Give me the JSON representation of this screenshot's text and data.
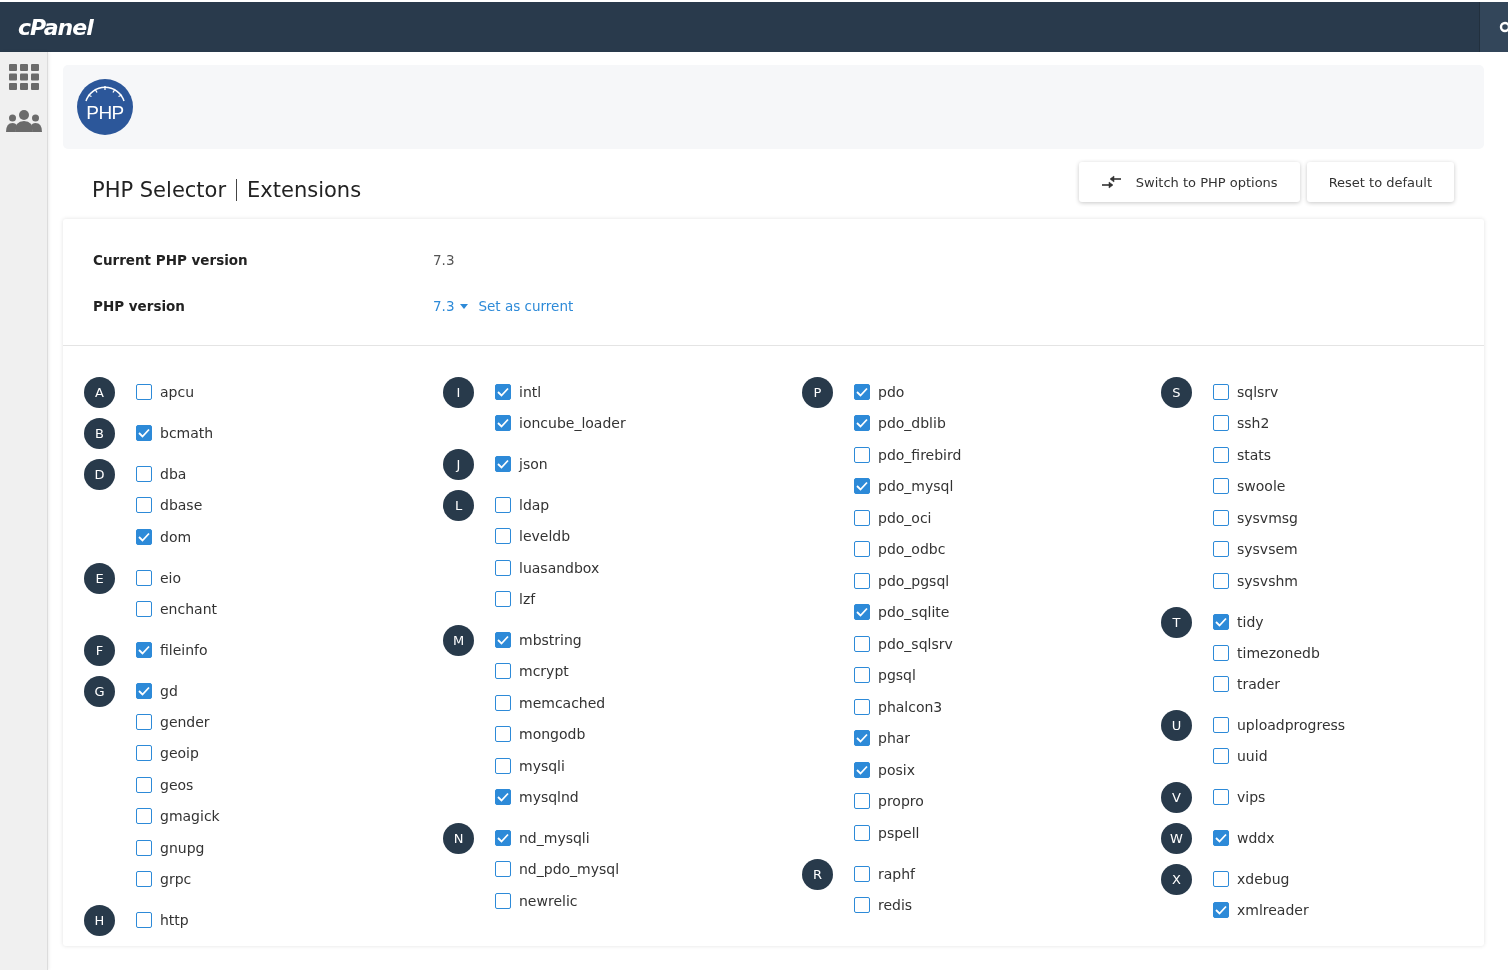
{
  "header": {
    "logo": "cPanel"
  },
  "banner": {
    "logo_text": "PHP"
  },
  "title": {
    "app": "PHP Selector",
    "section": "Extensions"
  },
  "buttons": [
    {
      "kind": "switch",
      "label": "Switch to PHP options"
    },
    {
      "kind": "plain",
      "label": "Reset to default"
    }
  ],
  "info": {
    "current_label": "Current PHP version",
    "current_value": "7.3",
    "version_label": "PHP version",
    "version_value": "7.3",
    "set_current": "Set as current"
  },
  "columns": [
    {
      "groups": [
        {
          "letter": "A",
          "extensions": [
            {
              "name": "apcu",
              "checked": false
            }
          ]
        },
        {
          "letter": "B",
          "extensions": [
            {
              "name": "bcmath",
              "checked": true
            }
          ]
        },
        {
          "letter": "D",
          "extensions": [
            {
              "name": "dba",
              "checked": false
            },
            {
              "name": "dbase",
              "checked": false
            },
            {
              "name": "dom",
              "checked": true
            }
          ]
        },
        {
          "letter": "E",
          "extensions": [
            {
              "name": "eio",
              "checked": false
            },
            {
              "name": "enchant",
              "checked": false
            }
          ]
        },
        {
          "letter": "F",
          "extensions": [
            {
              "name": "fileinfo",
              "checked": true
            }
          ]
        },
        {
          "letter": "G",
          "extensions": [
            {
              "name": "gd",
              "checked": true
            },
            {
              "name": "gender",
              "checked": false
            },
            {
              "name": "geoip",
              "checked": false
            },
            {
              "name": "geos",
              "checked": false
            },
            {
              "name": "gmagick",
              "checked": false
            },
            {
              "name": "gnupg",
              "checked": false
            },
            {
              "name": "grpc",
              "checked": false
            }
          ]
        },
        {
          "letter": "H",
          "extensions": [
            {
              "name": "http",
              "checked": false
            }
          ]
        }
      ]
    },
    {
      "groups": [
        {
          "letter": "I",
          "extensions": [
            {
              "name": "intl",
              "checked": true
            },
            {
              "name": "ioncube_loader",
              "checked": true
            }
          ]
        },
        {
          "letter": "J",
          "extensions": [
            {
              "name": "json",
              "checked": true
            }
          ]
        },
        {
          "letter": "L",
          "extensions": [
            {
              "name": "ldap",
              "checked": false
            },
            {
              "name": "leveldb",
              "checked": false
            },
            {
              "name": "luasandbox",
              "checked": false
            },
            {
              "name": "lzf",
              "checked": false
            }
          ]
        },
        {
          "letter": "M",
          "extensions": [
            {
              "name": "mbstring",
              "checked": true
            },
            {
              "name": "mcrypt",
              "checked": false
            },
            {
              "name": "memcached",
              "checked": false
            },
            {
              "name": "mongodb",
              "checked": false
            },
            {
              "name": "mysqli",
              "checked": false
            },
            {
              "name": "mysqlnd",
              "checked": true
            }
          ]
        },
        {
          "letter": "N",
          "extensions": [
            {
              "name": "nd_mysqli",
              "checked": true
            },
            {
              "name": "nd_pdo_mysql",
              "checked": false
            },
            {
              "name": "newrelic",
              "checked": false
            }
          ]
        }
      ]
    },
    {
      "groups": [
        {
          "letter": "P",
          "extensions": [
            {
              "name": "pdo",
              "checked": true
            },
            {
              "name": "pdo_dblib",
              "checked": true
            },
            {
              "name": "pdo_firebird",
              "checked": false
            },
            {
              "name": "pdo_mysql",
              "checked": true
            },
            {
              "name": "pdo_oci",
              "checked": false
            },
            {
              "name": "pdo_odbc",
              "checked": false
            },
            {
              "name": "pdo_pgsql",
              "checked": false
            },
            {
              "name": "pdo_sqlite",
              "checked": true
            },
            {
              "name": "pdo_sqlsrv",
              "checked": false
            },
            {
              "name": "pgsql",
              "checked": false
            },
            {
              "name": "phalcon3",
              "checked": false
            },
            {
              "name": "phar",
              "checked": true
            },
            {
              "name": "posix",
              "checked": true
            },
            {
              "name": "propro",
              "checked": false
            },
            {
              "name": "pspell",
              "checked": false
            }
          ]
        },
        {
          "letter": "R",
          "extensions": [
            {
              "name": "raphf",
              "checked": false
            },
            {
              "name": "redis",
              "checked": false
            }
          ]
        }
      ]
    },
    {
      "groups": [
        {
          "letter": "S",
          "extensions": [
            {
              "name": "sqlsrv",
              "checked": false
            },
            {
              "name": "ssh2",
              "checked": false
            },
            {
              "name": "stats",
              "checked": false
            },
            {
              "name": "swoole",
              "checked": false
            },
            {
              "name": "sysvmsg",
              "checked": false
            },
            {
              "name": "sysvsem",
              "checked": false
            },
            {
              "name": "sysvshm",
              "checked": false
            }
          ]
        },
        {
          "letter": "T",
          "extensions": [
            {
              "name": "tidy",
              "checked": true
            },
            {
              "name": "timezonedb",
              "checked": false
            },
            {
              "name": "trader",
              "checked": false
            }
          ]
        },
        {
          "letter": "U",
          "extensions": [
            {
              "name": "uploadprogress",
              "checked": false
            },
            {
              "name": "uuid",
              "checked": false
            }
          ]
        },
        {
          "letter": "V",
          "extensions": [
            {
              "name": "vips",
              "checked": false
            }
          ]
        },
        {
          "letter": "W",
          "extensions": [
            {
              "name": "wddx",
              "checked": true
            }
          ]
        },
        {
          "letter": "X",
          "extensions": [
            {
              "name": "xdebug",
              "checked": false
            },
            {
              "name": "xmlreader",
              "checked": true
            }
          ]
        }
      ]
    }
  ]
}
